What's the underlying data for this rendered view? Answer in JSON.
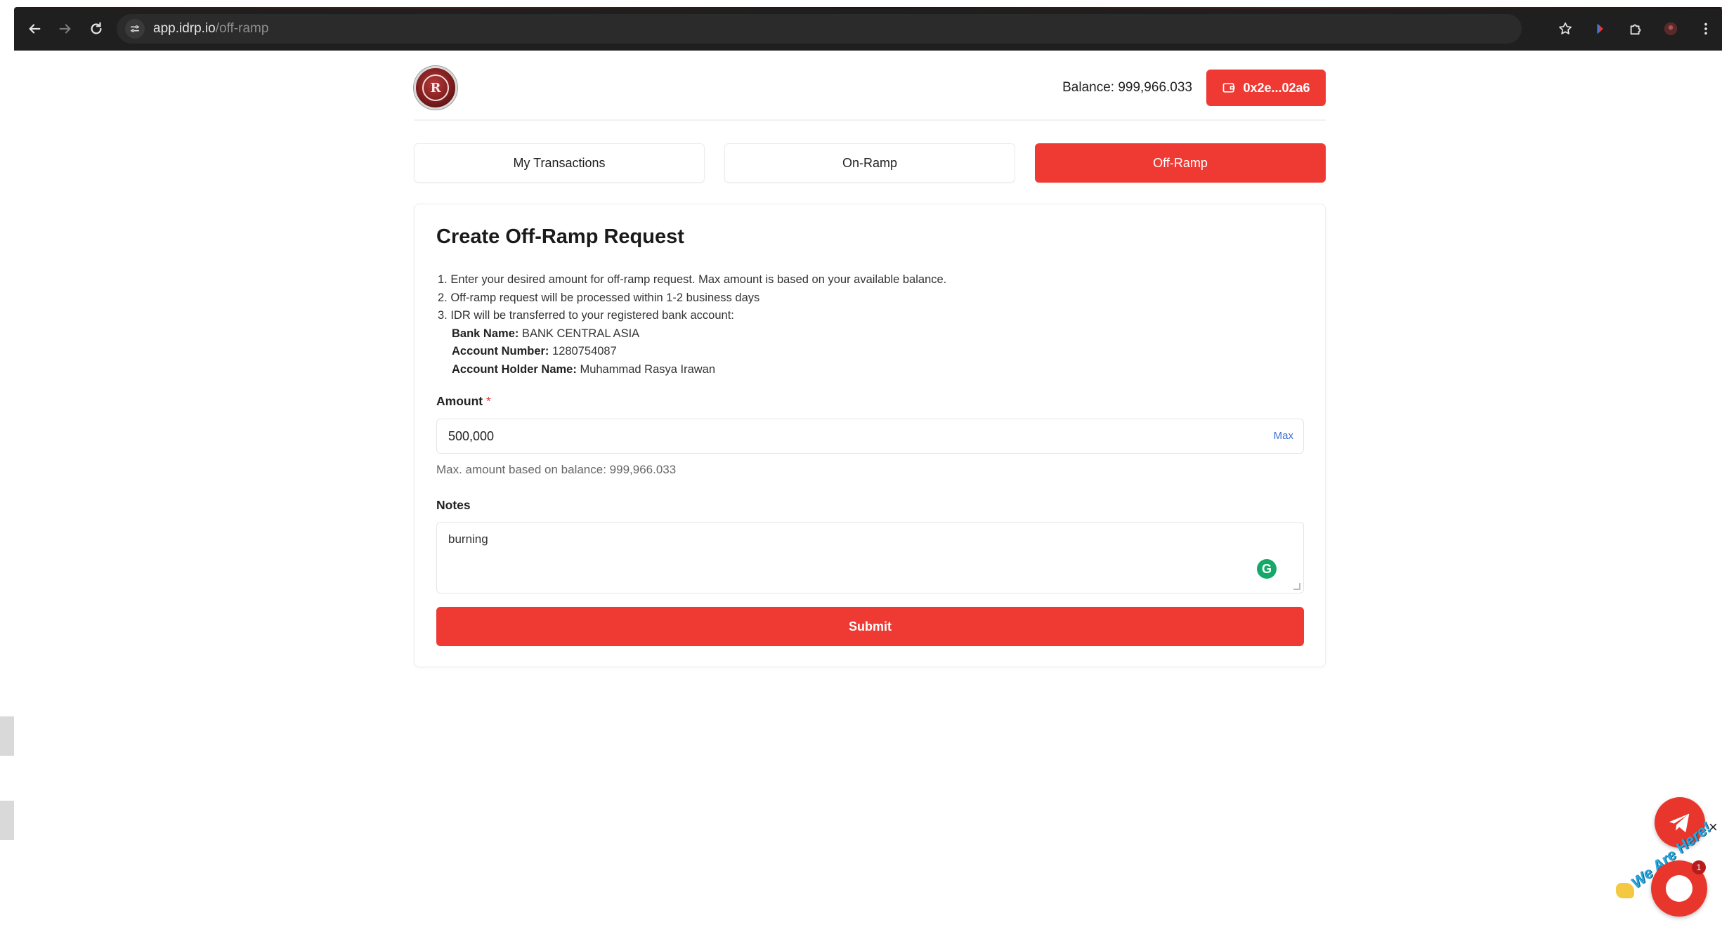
{
  "browser": {
    "url_host": "app.idrp.io",
    "url_path": "/off-ramp"
  },
  "header": {
    "balance_label": "Balance: 999,966.033",
    "wallet_address": "0x2e...02a6"
  },
  "tabs": [
    {
      "label": "My Transactions",
      "active": false
    },
    {
      "label": "On-Ramp",
      "active": false
    },
    {
      "label": "Off-Ramp",
      "active": true
    }
  ],
  "form": {
    "title": "Create Off-Ramp Request",
    "instructions": [
      "1. Enter your desired amount for off-ramp request. Max amount is based on your available balance.",
      "2. Off-ramp request will be processed within 1-2 business days",
      "3. IDR will be transferred to your registered bank account:"
    ],
    "bank": {
      "bank_name_label": "Bank Name:",
      "bank_name_value": "BANK CENTRAL ASIA",
      "account_number_label": "Account Number:",
      "account_number_value": "1280754087",
      "holder_label": "Account Holder Name:",
      "holder_value": "Muhammad Rasya Irawan"
    },
    "amount_label": "Amount",
    "amount_required_mark": "*",
    "amount_value": "500,000",
    "max_label": "Max",
    "amount_hint": "Max. amount based on balance: 999,966.033",
    "notes_label": "Notes",
    "notes_value": "burning",
    "submit_label": "Submit"
  },
  "widget": {
    "badge_count": "1",
    "close_label": "×",
    "tagline": "We Are Here!"
  },
  "colors": {
    "accent": "#ef3a34",
    "link": "#3b6fd6",
    "grammarly": "#15a868"
  },
  "icons": [
    "back-arrow-icon",
    "forward-arrow-icon",
    "reload-icon",
    "site-settings-icon",
    "star-icon",
    "extension-icon",
    "puzzle-icon",
    "profile-icon",
    "more-icon",
    "wallet-icon",
    "telegram-icon",
    "chat-icon",
    "grammarly-icon"
  ]
}
